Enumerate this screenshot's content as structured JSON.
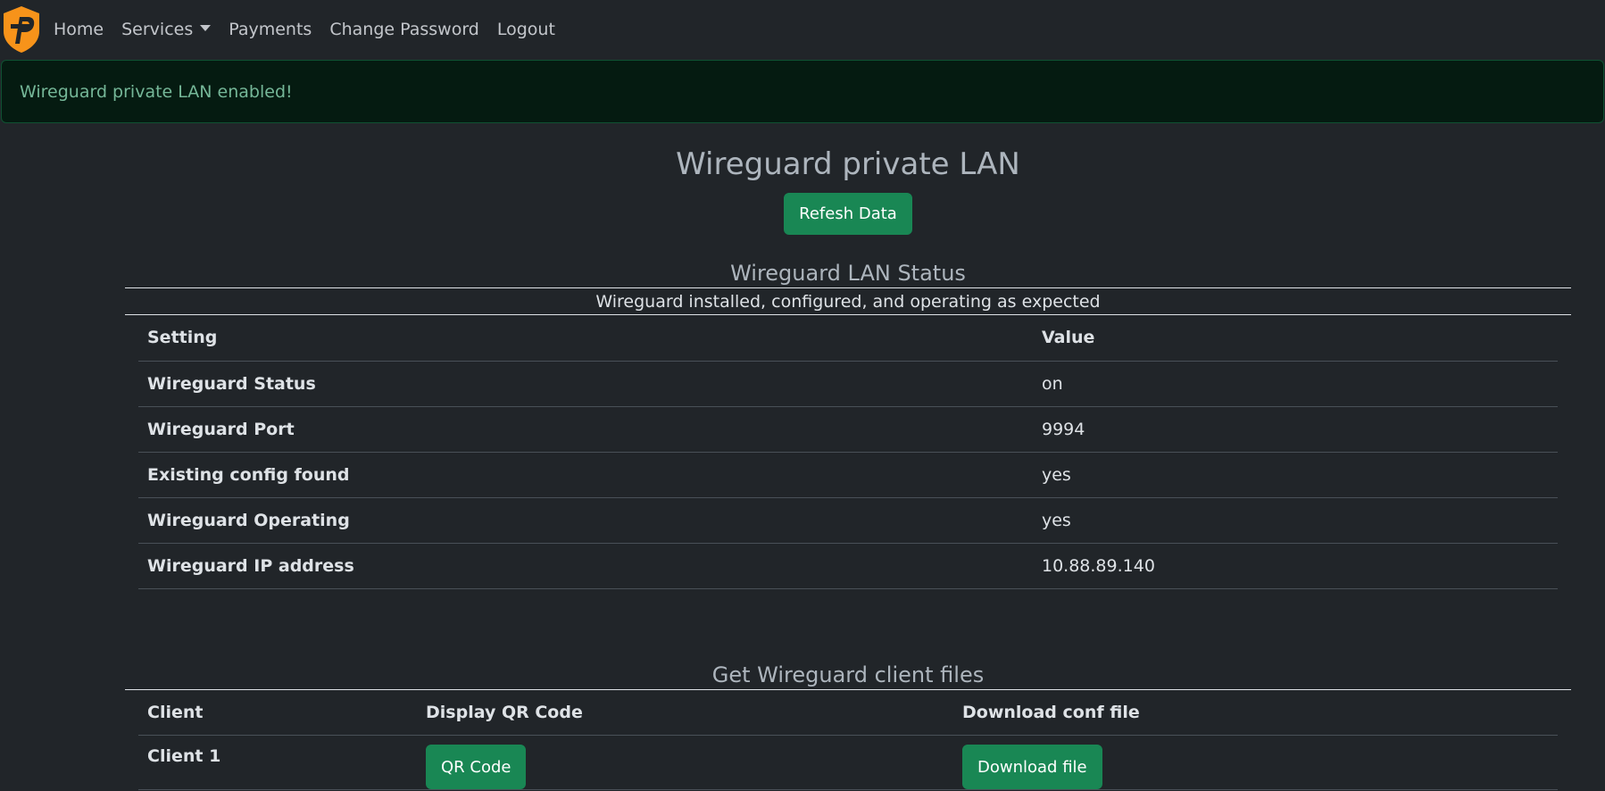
{
  "nav": {
    "items": [
      {
        "label": "Home"
      },
      {
        "label": "Services"
      },
      {
        "label": "Payments"
      },
      {
        "label": "Change Password"
      },
      {
        "label": "Logout"
      }
    ]
  },
  "alert": {
    "text": "Wireguard private LAN enabled!"
  },
  "page": {
    "title": "Wireguard private LAN",
    "refresh_label": "Refesh Data"
  },
  "status": {
    "title": "Wireguard LAN Status",
    "message": "Wireguard installed, configured, and operating as expected",
    "headers": {
      "setting": "Setting",
      "value": "Value"
    },
    "rows": [
      {
        "setting": "Wireguard Status",
        "value": "on"
      },
      {
        "setting": "Wireguard Port",
        "value": "9994"
      },
      {
        "setting": "Existing config found",
        "value": "yes"
      },
      {
        "setting": "Wireguard Operating",
        "value": "yes"
      },
      {
        "setting": "Wireguard IP address",
        "value": "10.88.89.140"
      }
    ]
  },
  "files": {
    "title": "Get Wireguard client files",
    "headers": {
      "client": "Client",
      "qr": "Display QR Code",
      "download": "Download conf file"
    },
    "rows": [
      {
        "client": "Client 1",
        "qr_label": "QR Code",
        "download_label": "Download file"
      }
    ]
  },
  "colors": {
    "background": "#212529",
    "success": "#198754",
    "logo": "#f7931a"
  }
}
